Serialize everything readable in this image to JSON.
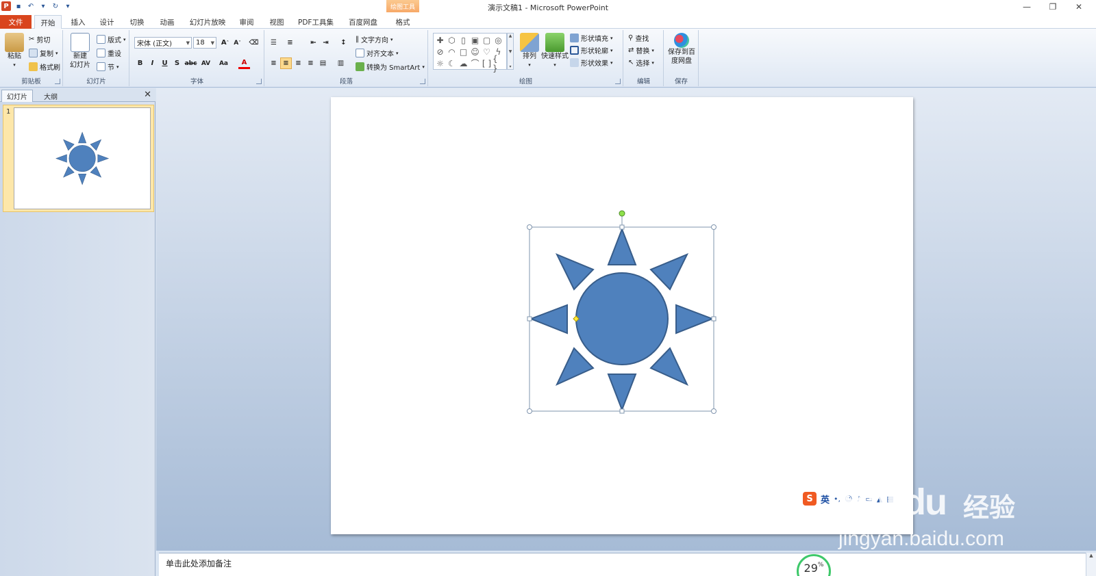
{
  "window": {
    "title": "演示文稿1 - Microsoft PowerPoint",
    "minimize": "—",
    "restore": "❐",
    "close": "✕"
  },
  "quick_access": [
    "save-icon",
    "undo-icon",
    "redo-icon",
    "customize-icon"
  ],
  "tabs": {
    "file": "文件",
    "home": "开始",
    "insert": "插入",
    "design": "设计",
    "transitions": "切换",
    "animations": "动画",
    "slideshow": "幻灯片放映",
    "review": "审阅",
    "view": "视图",
    "pdf": "PDF工具集",
    "baidu": "百度网盘",
    "contextual_group": "绘图工具",
    "format": "格式"
  },
  "ribbon": {
    "clipboard": {
      "label": "剪贴板",
      "paste": "粘贴",
      "cut": "剪切",
      "copy": "复制",
      "format_painter": "格式刷"
    },
    "slides": {
      "label": "幻灯片",
      "new_slide_line1": "新建",
      "new_slide_line2": "幻灯片",
      "layout": "版式",
      "reset": "重设",
      "section": "节"
    },
    "font": {
      "label": "字体",
      "font_name": "宋体 (正文)",
      "font_size": "18",
      "bold": "B",
      "italic": "I",
      "underline": "U",
      "shadow": "S",
      "strike": "abc",
      "spacing": "AV",
      "case": "Aa",
      "color": "A"
    },
    "paragraph": {
      "label": "段落",
      "text_direction": "文字方向",
      "align_text": "对齐文本",
      "convert_smartart": "转换为 SmartArt"
    },
    "drawing": {
      "label": "绘图",
      "arrange": "排列",
      "quick_styles": "快速样式",
      "shape_fill": "形状填充",
      "shape_outline": "形状轮廓",
      "shape_effects": "形状效果"
    },
    "editing": {
      "label": "编辑",
      "find": "查找",
      "replace": "替换",
      "select": "选择"
    },
    "save": {
      "label": "保存",
      "save_baidu_line1": "保存到百",
      "save_baidu_line2": "度网盘"
    }
  },
  "panel": {
    "tab_slides": "幻灯片",
    "tab_outline": "大纲",
    "close": "✕",
    "slide_number": "1"
  },
  "notes": {
    "placeholder": "单击此处添加备注"
  },
  "progress": {
    "value": "29",
    "unit": "%"
  },
  "ime": {
    "lang": "英"
  },
  "watermark": {
    "logo": "Bai du",
    "brand": "经验",
    "url": "jingyan.baidu.com"
  },
  "colors": {
    "sun_fill": "#4f81bd",
    "sun_stroke": "#385d8a",
    "file_tab": "#d9451d",
    "progress_ring": "#3ec86a"
  }
}
